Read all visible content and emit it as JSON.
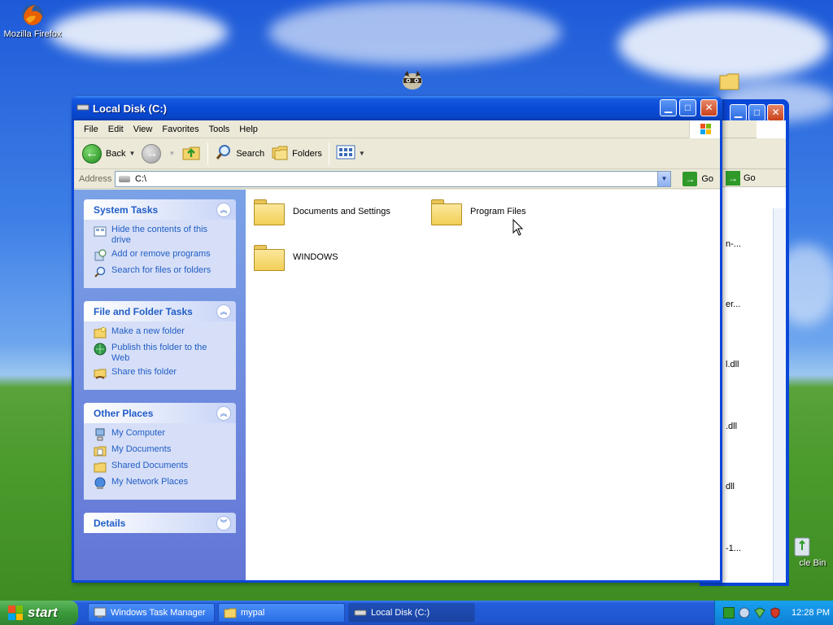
{
  "desktop": {
    "icons": [
      {
        "label": "Mozilla Firefox"
      },
      {
        "label": "cle Bin"
      }
    ]
  },
  "background_window": {
    "address_go": "Go",
    "rows": [
      "n-...",
      "er...",
      "l.dll",
      ".dll",
      "dll",
      "-1..."
    ]
  },
  "window": {
    "title": "Local Disk (C:)",
    "menu": [
      "File",
      "Edit",
      "View",
      "Favorites",
      "Tools",
      "Help"
    ],
    "toolbar": {
      "back": "Back",
      "search": "Search",
      "folders": "Folders"
    },
    "address": {
      "label": "Address",
      "value": "C:\\",
      "go": "Go"
    },
    "panels": [
      {
        "title": "System Tasks",
        "items": [
          {
            "label": "Hide the contents of this drive",
            "icon": "hide-contents-icon"
          },
          {
            "label": "Add or remove programs",
            "icon": "add-remove-programs-icon"
          },
          {
            "label": "Search for files or folders",
            "icon": "search-icon"
          }
        ]
      },
      {
        "title": "File and Folder Tasks",
        "items": [
          {
            "label": "Make a new folder",
            "icon": "new-folder-icon"
          },
          {
            "label": "Publish this folder to the Web",
            "icon": "web-publish-icon"
          },
          {
            "label": "Share this folder",
            "icon": "share-folder-icon"
          }
        ]
      },
      {
        "title": "Other Places",
        "items": [
          {
            "label": "My Computer",
            "icon": "my-computer-icon"
          },
          {
            "label": "My Documents",
            "icon": "my-documents-icon"
          },
          {
            "label": "Shared Documents",
            "icon": "shared-documents-icon"
          },
          {
            "label": "My Network Places",
            "icon": "network-places-icon"
          }
        ]
      },
      {
        "title": "Details",
        "items": []
      }
    ],
    "files": [
      {
        "name": "Documents and Settings"
      },
      {
        "name": "Program Files"
      },
      {
        "name": "WINDOWS"
      }
    ]
  },
  "taskbar": {
    "start": "start",
    "buttons": [
      {
        "label": "Windows Task Manager"
      },
      {
        "label": "mypal"
      },
      {
        "label": "Local Disk (C:)"
      }
    ],
    "clock": "12:28 PM"
  }
}
